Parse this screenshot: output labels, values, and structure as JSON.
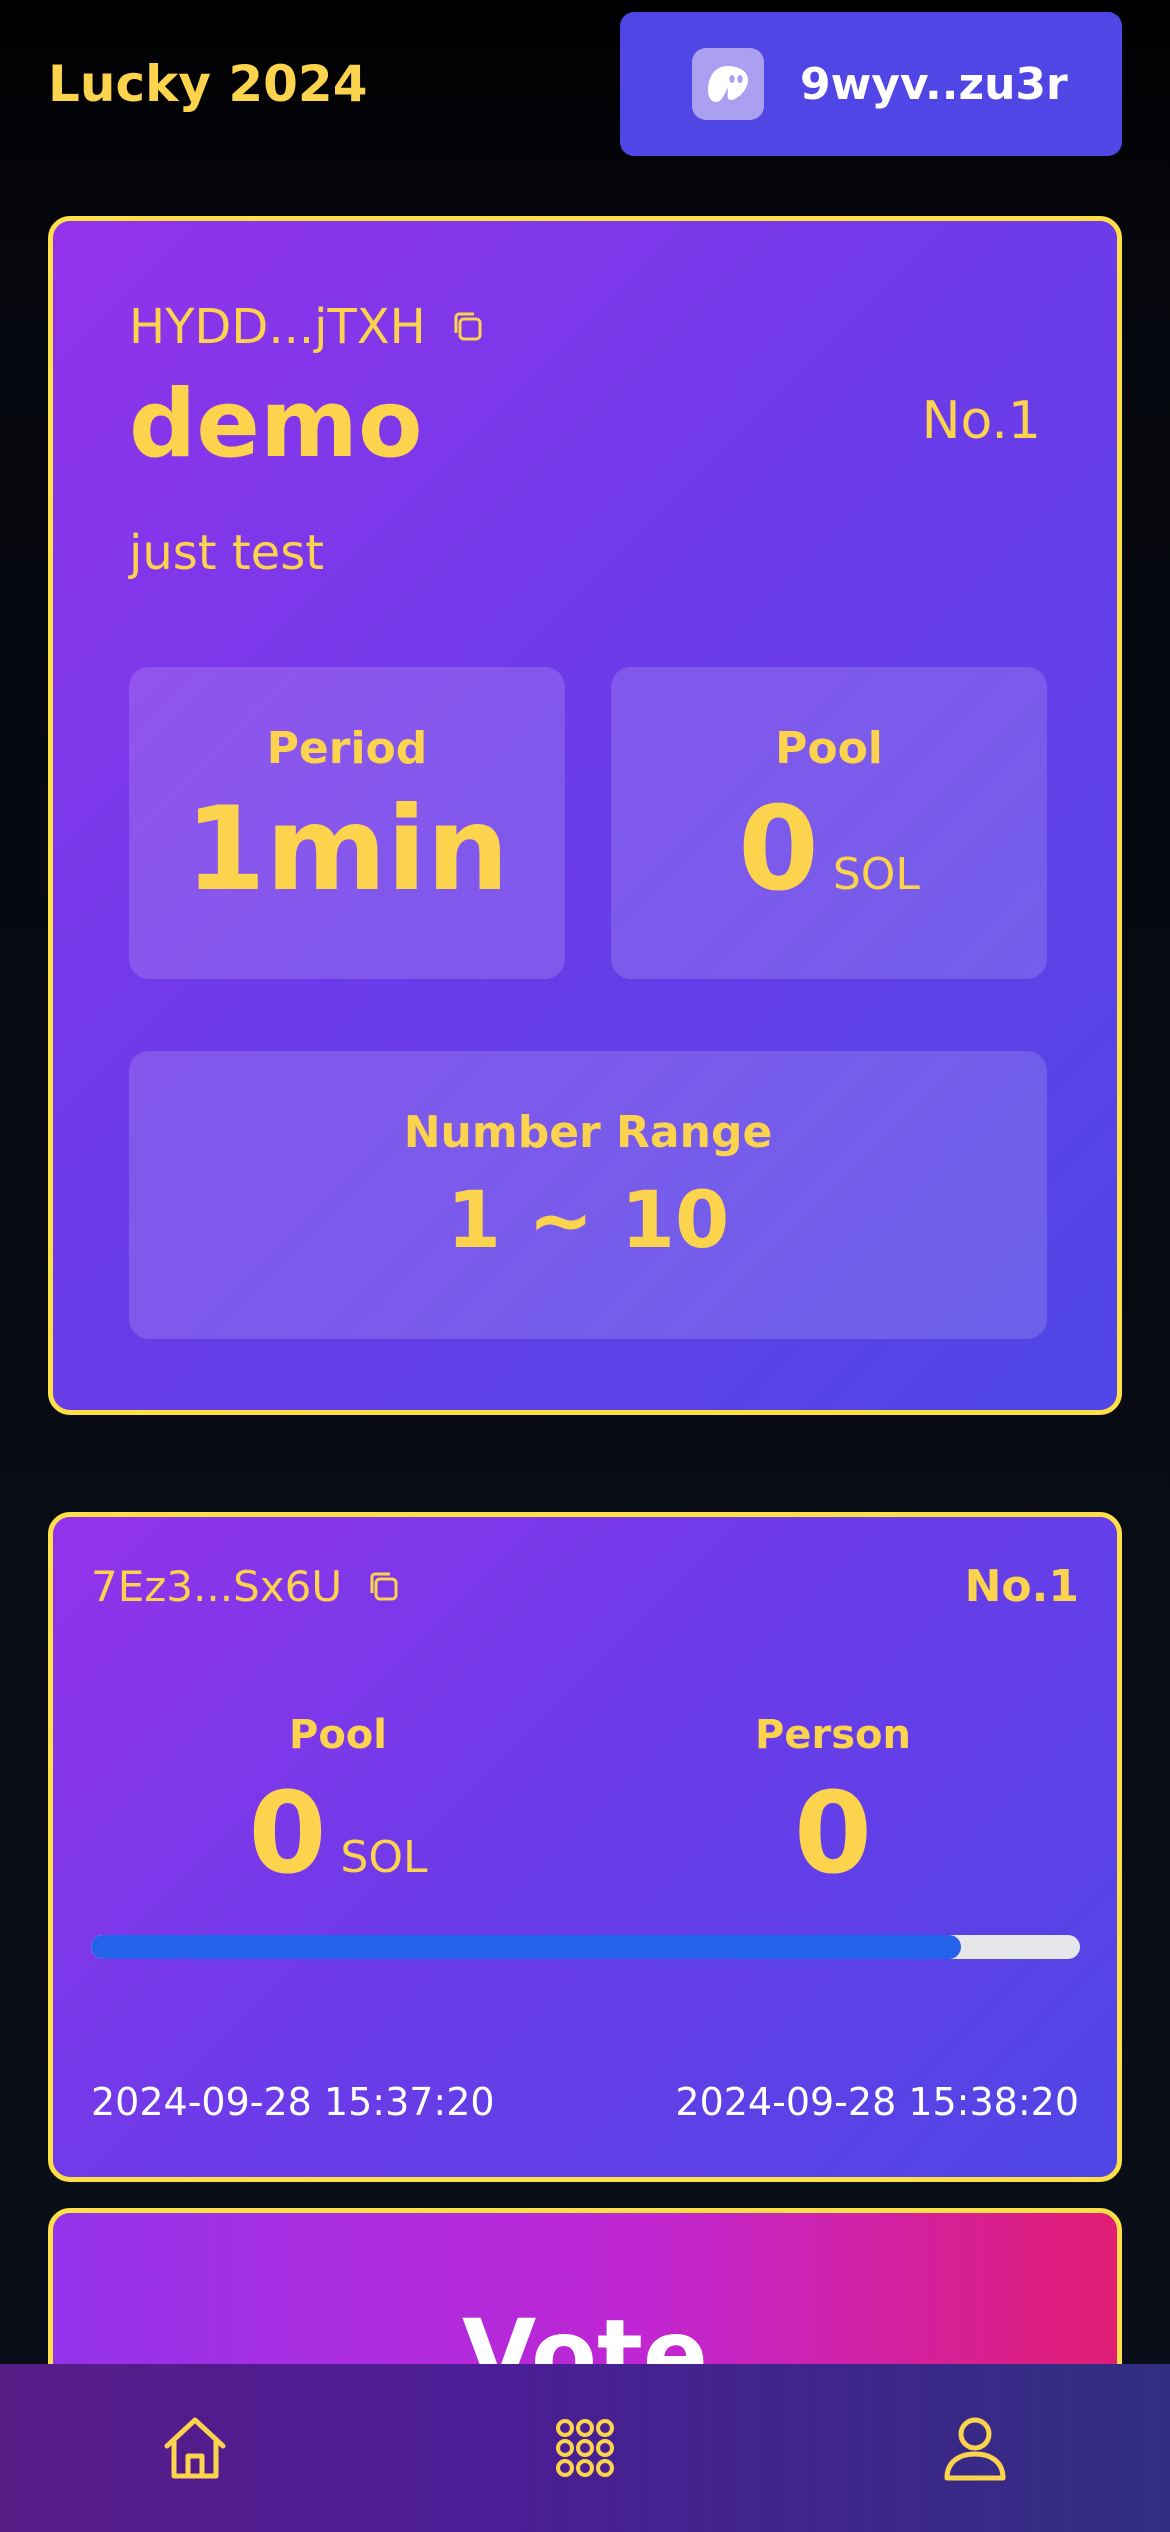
{
  "header": {
    "app_title": "Lucky 2024",
    "wallet_address": "9wyv..zu3r",
    "wallet_icon": "ghost-icon"
  },
  "game": {
    "address": "HYDD...jTXH",
    "name": "demo",
    "rank": "No.1",
    "description": "just test",
    "period_label": "Period",
    "period_value": "1min",
    "pool_label": "Pool",
    "pool_value": "0",
    "pool_unit": "SOL",
    "range_label": "Number Range",
    "range_value": "1 ~ 10"
  },
  "round": {
    "address": "7Ez3...Sx6U",
    "rank": "No.1",
    "pool_label": "Pool",
    "pool_value": "0",
    "pool_unit": "SOL",
    "person_label": "Person",
    "person_value": "0",
    "progress_percent": 88,
    "start_time": "2024-09-28 15:37:20",
    "end_time": "2024-09-28 15:38:20"
  },
  "vote": {
    "label": "Vote"
  },
  "nav": {
    "items": [
      {
        "icon": "home-icon"
      },
      {
        "icon": "grid-icon"
      },
      {
        "icon": "user-icon"
      }
    ]
  },
  "colors": {
    "accent": "#fcd34d",
    "card_border": "#fde047",
    "wallet_button": "#4f46e5",
    "progress_fill": "#2563eb",
    "progress_track": "#e5e7eb"
  }
}
